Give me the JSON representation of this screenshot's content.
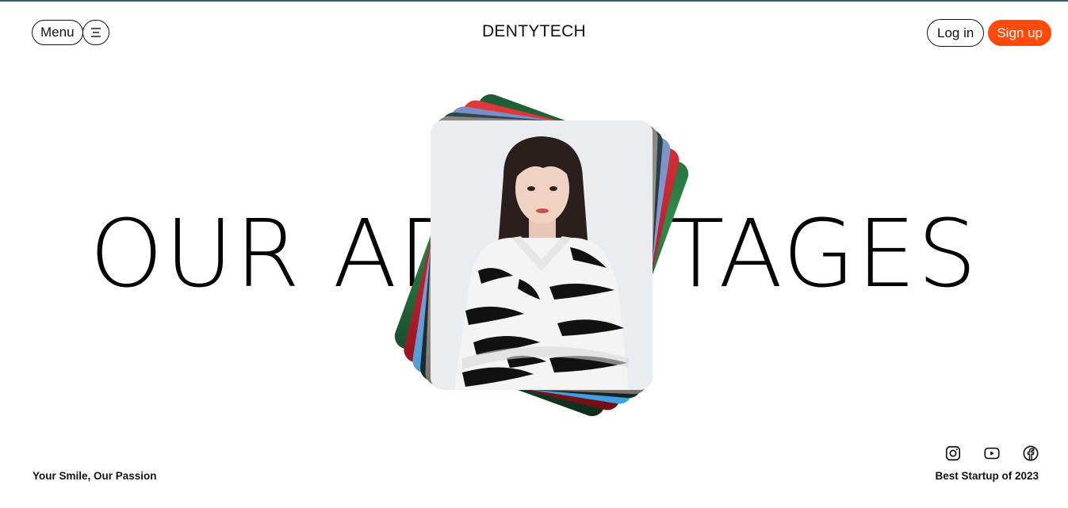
{
  "header": {
    "menu_label": "Menu",
    "menu_icon": "hamburger-icon",
    "brand": "DENTYTECH",
    "login_label": "Log in",
    "signup_label": "Sign up"
  },
  "hero": {
    "title": "OUR ADVANTAGES"
  },
  "footer": {
    "tagline": "Your Smile, Our Passion",
    "award": "Best Startup of 2023",
    "socials": [
      "instagram-icon",
      "youtube-icon",
      "facebook-icon"
    ]
  },
  "colors": {
    "accent": "#ff4a0a",
    "text": "#111111",
    "top_line": "#2f5f6b"
  }
}
